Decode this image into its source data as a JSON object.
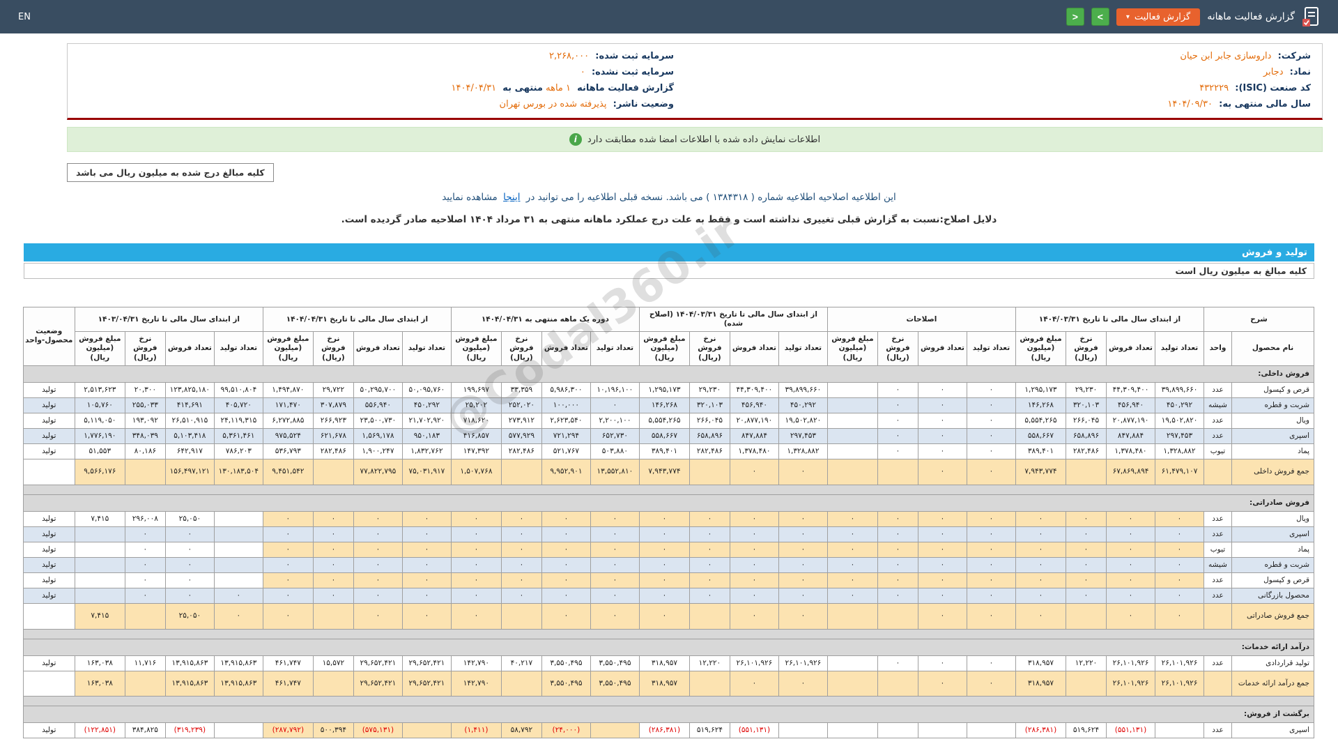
{
  "topbar": {
    "en_label": "EN",
    "title": "گزارش فعالیت ماهانه",
    "report_button": "گزارش فعالیت",
    "caret": "▾",
    "next_arrow": ">",
    "prev_arrow": "<"
  },
  "company": {
    "right": [
      {
        "label": "شرکت:",
        "value": "داروسازی جابر ابن حیان"
      },
      {
        "label": "نماد:",
        "value": "دجابر"
      },
      {
        "label": "کد صنعت (ISIC):",
        "value": "۴۳۲۲۲۹"
      },
      {
        "label": "سال مالی منتهی به:",
        "value": "۱۴۰۴/۰۹/۳۰"
      }
    ],
    "left": [
      {
        "label": "سرمایه ثبت شده:",
        "value": "۲,۲۶۸,۰۰۰",
        "label2": "",
        "value2": ""
      },
      {
        "label": "سرمایه ثبت نشده:",
        "value": "۰",
        "label2": "",
        "value2": ""
      },
      {
        "label": "گزارش فعالیت ماهانه",
        "value": "۱ ماهه",
        "label2": "منتهی به",
        "value2": "۱۴۰۴/۰۴/۳۱"
      },
      {
        "label": "وضعیت ناشر:",
        "value": "پذیرفته شده در بورس تهران",
        "label2": "",
        "value2": ""
      }
    ]
  },
  "notices": {
    "signed_match": "اطلاعات نمایش داده شده با اطلاعات امضا شده مطابقت دارد",
    "million_box": "کلیه مبالغ درج شده به میلیون ریال می باشد",
    "amend_before": "این اطلاعیه اصلاحیه اطلاعیه شماره ( ۱۳۸۴۳۱۸ ) می باشد. نسخه قبلی اطلاعیه را می توانید در",
    "amend_link": "اینجا",
    "amend_after": "مشاهده نمایید",
    "reason": "دلایل اصلاح:نسبت به گزارش قبلی تغییری نداشته است و فقط به علت درج عملکرد ماهانه منتهی به ۳۱ مرداد ۱۴۰۴ اصلاحیه صادر گردیده است."
  },
  "section": {
    "title": "تولید و فروش",
    "subtitle": "کلیه مبالغ به میلیون ریال است"
  },
  "watermark": "@Codal360.ir",
  "table": {
    "desc_header": "شرح",
    "name_col": "نام محصول",
    "unit_col": "واحد",
    "status_header": "وضعیت محصول-واحد",
    "subcols": [
      "تعداد تولید",
      "تعداد فروش",
      "نرخ فروش (ریال)",
      "مبلغ فروش (میلیون ریال)"
    ],
    "groups": [
      "از ابتدای سال مالی تا تاریخ ۱۴۰۴/۰۳/۳۱",
      "اصلاحات",
      "از ابتدای سال مالی تا تاریخ ۱۴۰۴/۰۳/۳۱ (اصلاح شده)",
      "دوره یک ماهه منتهی به ۱۴۰۴/۰۴/۳۱",
      "از ابتدای سال مالی تا تاریخ ۱۴۰۴/۰۴/۳۱",
      "از ابتدای سال مالی تا تاریخ ۱۴۰۳/۰۴/۳۱"
    ],
    "rows": [
      {
        "type": "section",
        "name": "فروش داخلی:"
      },
      {
        "type": "data",
        "name": "قرص و کپسول",
        "unit": "عدد",
        "status": "تولید",
        "alt": false,
        "cream": [],
        "cells": [
          "۳۹,۸۹۹,۶۶۰",
          "۴۴,۳۰۹,۴۰۰",
          "۲۹,۲۳۰",
          "۱,۲۹۵,۱۷۳",
          "۰",
          "۰",
          "۰",
          "",
          "۳۹,۸۹۹,۶۶۰",
          "۴۴,۳۰۹,۴۰۰",
          "۲۹,۲۳۰",
          "۱,۲۹۵,۱۷۳",
          "۱۰,۱۹۶,۱۰۰",
          "۵,۹۸۶,۳۰۰",
          "۳۳,۳۵۹",
          "۱۹۹,۶۹۷",
          "۵۰,۰۹۵,۷۶۰",
          "۵۰,۲۹۵,۷۰۰",
          "۲۹,۷۲۲",
          "۱,۴۹۴,۸۷۰",
          "۹۹,۵۱۰,۸۰۴",
          "۱۲۳,۸۲۵,۱۸۰",
          "۲۰,۳۰۰",
          "۲,۵۱۳,۶۲۳"
        ]
      },
      {
        "type": "data",
        "name": "شربت و قطره",
        "unit": "شیشه",
        "status": "تولید",
        "alt": true,
        "cream": [],
        "cells": [
          "۴۵۰,۲۹۲",
          "۴۵۶,۹۴۰",
          "۳۲۰,۱۰۳",
          "۱۴۶,۲۶۸",
          "۰",
          "۰",
          "۰",
          "",
          "۴۵۰,۲۹۲",
          "۴۵۶,۹۴۰",
          "۳۲۰,۱۰۳",
          "۱۴۶,۲۶۸",
          "۰",
          "۱۰۰,۰۰۰",
          "۲۵۲,۰۲۰",
          "۲۵,۲۰۲",
          "۴۵۰,۲۹۲",
          "۵۵۶,۹۴۰",
          "۳۰۷,۸۷۹",
          "۱۷۱,۴۷۰",
          "۴۰۵,۷۲۰",
          "۴۱۴,۶۹۱",
          "۲۵۵,۰۳۳",
          "۱۰۵,۷۶۰"
        ]
      },
      {
        "type": "data",
        "name": "ویال",
        "unit": "عدد",
        "status": "تولید",
        "alt": false,
        "cream": [],
        "cells": [
          "۱۹,۵۰۲,۸۲۰",
          "۲۰,۸۷۷,۱۹۰",
          "۲۶۶,۰۴۵",
          "۵,۵۵۴,۲۶۵",
          "۰",
          "۰",
          "۰",
          "",
          "۱۹,۵۰۲,۸۲۰",
          "۲۰,۸۷۷,۱۹۰",
          "۲۶۶,۰۴۵",
          "۵,۵۵۴,۲۶۵",
          "۲,۲۰۰,۱۰۰",
          "۲,۶۲۳,۵۴۰",
          "۲۷۳,۹۱۲",
          "۷۱۸,۶۲۰",
          "۲۱,۷۰۲,۹۲۰",
          "۲۳,۵۰۰,۷۳۰",
          "۲۶۶,۹۲۳",
          "۶,۲۷۲,۸۸۵",
          "۲۴,۱۱۹,۳۱۵",
          "۲۶,۵۱۰,۹۱۵",
          "۱۹۳,۰۹۲",
          "۵,۱۱۹,۰۵۰"
        ]
      },
      {
        "type": "data",
        "name": "اسپری",
        "unit": "عدد",
        "status": "تولید",
        "alt": true,
        "cream": [],
        "cells": [
          "۲۹۷,۴۵۳",
          "۸۴۷,۸۸۴",
          "۶۵۸,۸۹۶",
          "۵۵۸,۶۶۷",
          "۰",
          "۰",
          "۰",
          "",
          "۲۹۷,۴۵۳",
          "۸۴۷,۸۸۴",
          "۶۵۸,۸۹۶",
          "۵۵۸,۶۶۷",
          "۶۵۲,۷۳۰",
          "۷۲۱,۲۹۴",
          "۵۷۷,۹۲۹",
          "۴۱۶,۸۵۷",
          "۹۵۰,۱۸۳",
          "۱,۵۶۹,۱۷۸",
          "۶۲۱,۶۷۸",
          "۹۷۵,۵۲۴",
          "۵,۳۶۱,۴۶۱",
          "۵,۱۰۳,۴۱۸",
          "۳۴۸,۰۳۹",
          "۱,۷۷۶,۱۹۰"
        ]
      },
      {
        "type": "data",
        "name": "پماد",
        "unit": "تیوب",
        "status": "تولید",
        "alt": false,
        "cream": [],
        "cells": [
          "۱,۳۲۸,۸۸۲",
          "۱,۳۷۸,۴۸۰",
          "۲۸۲,۴۸۶",
          "۳۸۹,۴۰۱",
          "۰",
          "۰",
          "۰",
          "",
          "۱,۳۲۸,۸۸۲",
          "۱,۳۷۸,۴۸۰",
          "۲۸۲,۴۸۶",
          "۳۸۹,۴۰۱",
          "۵۰۳,۸۸۰",
          "۵۲۱,۷۶۷",
          "۲۸۲,۴۸۶",
          "۱۴۷,۳۹۲",
          "۱,۸۳۲,۷۶۲",
          "۱,۹۰۰,۲۴۷",
          "۲۸۲,۴۸۶",
          "۵۳۶,۷۹۳",
          "۷۸۶,۲۰۳",
          "۶۴۲,۹۱۷",
          "۸۰,۱۸۶",
          "۵۱,۵۵۳"
        ]
      },
      {
        "type": "total",
        "name": "جمع فروش داخلی",
        "unit": "",
        "status": "",
        "alt": false,
        "cream": [
          0,
          1,
          2,
          3,
          4,
          5
        ],
        "cells": [
          "۶۱,۴۷۹,۱۰۷",
          "۶۷,۸۶۹,۸۹۴",
          "",
          "۷,۹۴۳,۷۷۴",
          "۰",
          "۰",
          "",
          "",
          "۰",
          "۰",
          "",
          "۷,۹۴۳,۷۷۴",
          "۱۳,۵۵۲,۸۱۰",
          "۹,۹۵۲,۹۰۱",
          "",
          "۱,۵۰۷,۷۶۸",
          "۷۵,۰۳۱,۹۱۷",
          "۷۷,۸۲۲,۷۹۵",
          "",
          "۹,۴۵۱,۵۴۲",
          "۱۳۰,۱۸۳,۵۰۴",
          "۱۵۶,۴۹۷,۱۲۱",
          "",
          "۹,۵۶۶,۱۷۶"
        ]
      },
      {
        "type": "spacer"
      },
      {
        "type": "section",
        "name": "فروش صادراتی:"
      },
      {
        "type": "data",
        "name": "ویال",
        "unit": "عدد",
        "status": "تولید",
        "alt": false,
        "cream": [
          0,
          1,
          2,
          3,
          4
        ],
        "cells": [
          "۰",
          "۰",
          "۰",
          "۰",
          "۰",
          "۰",
          "۰",
          "۰",
          "۰",
          "۰",
          "۰",
          "۰",
          "۰",
          "۰",
          "۰",
          "۰",
          "۰",
          "۰",
          "۰",
          "۰",
          "",
          "۲۵,۰۵۰",
          "۲۹۶,۰۰۸",
          "۷,۴۱۵"
        ]
      },
      {
        "type": "data",
        "name": "اسپری",
        "unit": "عدد",
        "status": "تولید",
        "alt": true,
        "cream": [
          0,
          1,
          2,
          3,
          4
        ],
        "cells": [
          "۰",
          "۰",
          "۰",
          "۰",
          "۰",
          "۰",
          "۰",
          "۰",
          "۰",
          "۰",
          "۰",
          "۰",
          "۰",
          "۰",
          "۰",
          "۰",
          "۰",
          "۰",
          "۰",
          "۰",
          "",
          "۰",
          "۰",
          ""
        ]
      },
      {
        "type": "data",
        "name": "پماد",
        "unit": "تیوب",
        "status": "تولید",
        "alt": false,
        "cream": [
          0,
          1,
          2,
          3,
          4
        ],
        "cells": [
          "۰",
          "۰",
          "۰",
          "۰",
          "۰",
          "۰",
          "۰",
          "۰",
          "۰",
          "۰",
          "۰",
          "۰",
          "۰",
          "۰",
          "۰",
          "۰",
          "۰",
          "۰",
          "۰",
          "۰",
          "",
          "۰",
          "۰",
          ""
        ]
      },
      {
        "type": "data",
        "name": "شربت و قطره",
        "unit": "شیشه",
        "status": "تولید",
        "alt": true,
        "cream": [
          0,
          1,
          2,
          3,
          4
        ],
        "cells": [
          "۰",
          "۰",
          "۰",
          "۰",
          "۰",
          "۰",
          "۰",
          "۰",
          "۰",
          "۰",
          "۰",
          "۰",
          "۰",
          "۰",
          "۰",
          "۰",
          "۰",
          "۰",
          "۰",
          "۰",
          "",
          "۰",
          "۰",
          ""
        ]
      },
      {
        "type": "data",
        "name": "قرص و کپسول",
        "unit": "عدد",
        "status": "تولید",
        "alt": false,
        "cream": [
          0,
          1,
          2,
          3,
          4
        ],
        "cells": [
          "۰",
          "۰",
          "۰",
          "۰",
          "۰",
          "۰",
          "۰",
          "۰",
          "۰",
          "۰",
          "۰",
          "۰",
          "۰",
          "۰",
          "۰",
          "۰",
          "۰",
          "۰",
          "۰",
          "۰",
          "",
          "۰",
          "۰",
          ""
        ]
      },
      {
        "type": "data",
        "name": "محصول بازرگانی",
        "unit": "عدد",
        "status": "تولید",
        "alt": true,
        "cream": [
          0,
          1,
          2,
          3,
          4
        ],
        "cells": [
          "۰",
          "۰",
          "۰",
          "۰",
          "۰",
          "۰",
          "۰",
          "۰",
          "۰",
          "۰",
          "۰",
          "۰",
          "۰",
          "۰",
          "۰",
          "۰",
          "۰",
          "۰",
          "۰",
          "۰",
          "۰",
          "۰",
          "۰",
          ""
        ]
      },
      {
        "type": "total",
        "name": "جمع فروش صادراتی",
        "unit": "",
        "status": "",
        "alt": false,
        "cream": [
          0,
          1,
          2,
          3,
          4,
          5
        ],
        "cells": [
          "۰",
          "۰",
          "",
          "۰",
          "۰",
          "۰",
          "",
          "",
          "۰",
          "۰",
          "",
          "۰",
          "۰",
          "۰",
          "",
          "۰",
          "۰",
          "۰",
          "",
          "۰",
          "۰",
          "۲۵,۰۵۰",
          "",
          "۷,۴۱۵"
        ]
      },
      {
        "type": "spacer"
      },
      {
        "type": "section",
        "name": "درآمد ارائه خدمات:"
      },
      {
        "type": "data",
        "name": "تولید قراردادی",
        "unit": "عدد",
        "status": "تولید",
        "alt": false,
        "cream": [],
        "cells": [
          "۲۶,۱۰۱,۹۲۶",
          "۲۶,۱۰۱,۹۲۶",
          "۱۲,۲۲۰",
          "۳۱۸,۹۵۷",
          "۰",
          "۰",
          "۰",
          "",
          "۲۶,۱۰۱,۹۲۶",
          "۲۶,۱۰۱,۹۲۶",
          "۱۲,۲۲۰",
          "۳۱۸,۹۵۷",
          "۳,۵۵۰,۴۹۵",
          "۳,۵۵۰,۴۹۵",
          "۴۰,۲۱۷",
          "۱۴۲,۷۹۰",
          "۲۹,۶۵۲,۴۲۱",
          "۲۹,۶۵۲,۴۲۱",
          "۱۵,۵۷۲",
          "۴۶۱,۷۴۷",
          "۱۳,۹۱۵,۸۶۳",
          "۱۳,۹۱۵,۸۶۳",
          "۱۱,۷۱۶",
          "۱۶۳,۰۳۸"
        ]
      },
      {
        "type": "total",
        "name": "جمع درآمد ارائه خدمات",
        "unit": "",
        "status": "",
        "alt": false,
        "cream": [
          0,
          1,
          2,
          3,
          4,
          5
        ],
        "cells": [
          "۲۶,۱۰۱,۹۲۶",
          "۲۶,۱۰۱,۹۲۶",
          "",
          "۳۱۸,۹۵۷",
          "۰",
          "۰",
          "",
          "",
          "۰",
          "۰",
          "",
          "۳۱۸,۹۵۷",
          "۳,۵۵۰,۴۹۵",
          "۳,۵۵۰,۴۹۵",
          "",
          "۱۴۲,۷۹۰",
          "۲۹,۶۵۲,۴۲۱",
          "۲۹,۶۵۲,۴۲۱",
          "",
          "۴۶۱,۷۴۷",
          "۱۳,۹۱۵,۸۶۳",
          "۱۳,۹۱۵,۸۶۳",
          "",
          "۱۶۳,۰۳۸"
        ]
      },
      {
        "type": "spacer"
      },
      {
        "type": "section",
        "name": "برگشت از فروش:"
      },
      {
        "type": "data",
        "name": "اسپری",
        "unit": "عدد",
        "status": "تولید",
        "alt": false,
        "cream": [
          3,
          4
        ],
        "cells": [
          "",
          "(۵۵۱,۱۳۱)",
          "۵۱۹,۶۲۴",
          "(۲۸۶,۳۸۱)",
          "",
          "",
          "",
          "",
          "",
          "(۵۵۱,۱۳۱)",
          "۵۱۹,۶۲۴",
          "(۲۸۶,۳۸۱)",
          "",
          "(۲۴,۰۰۰)",
          "۵۸,۷۹۲",
          "(۱,۴۱۱)",
          "",
          "(۵۷۵,۱۳۱)",
          "۵۰۰,۳۹۴",
          "(۲۸۷,۷۹۲)",
          "",
          "(۳۱۹,۲۳۹)",
          "۳۸۴,۸۲۵",
          "(۱۲۲,۸۵۱)"
        ]
      }
    ]
  }
}
